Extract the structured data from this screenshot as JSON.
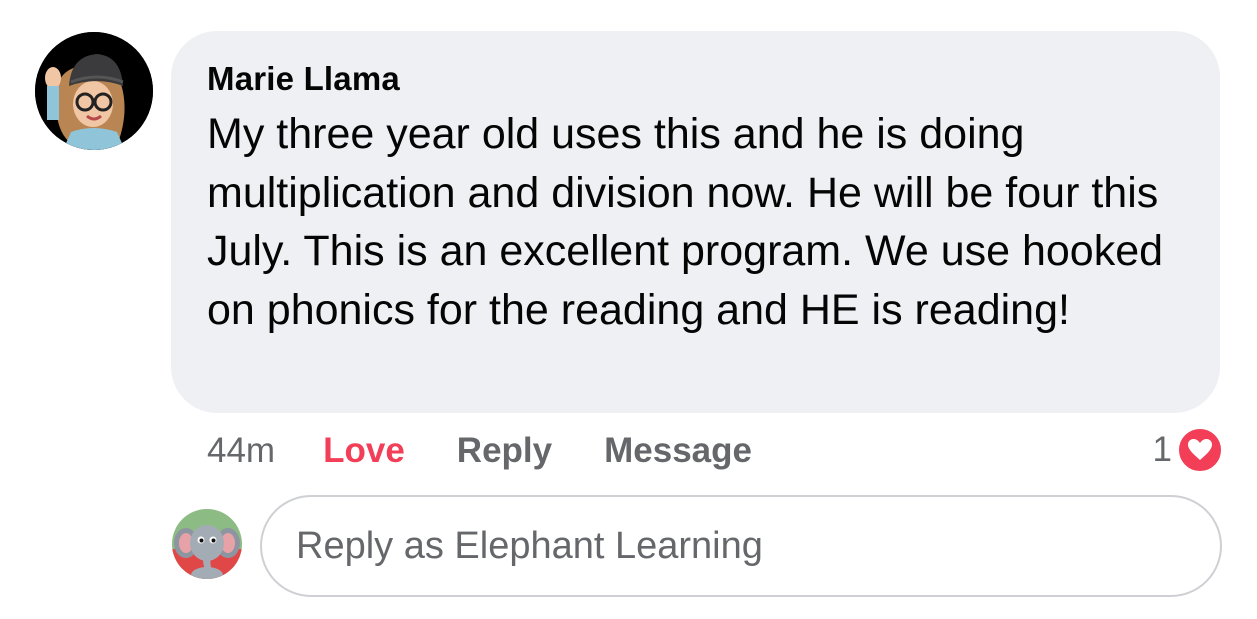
{
  "comment": {
    "author": "Marie Llama",
    "text": "My three year old uses this and he is doing multiplication and division now. He will be four this July. This is an excellent program. We use hooked on phonics for the reading and HE is reading!",
    "avatar_icon": "user-avatar"
  },
  "actions": {
    "time": "44m",
    "love_label": "Love",
    "reply_label": "Reply",
    "message_label": "Message"
  },
  "reactions": {
    "count": "1",
    "icon": "heart-icon"
  },
  "reply_box": {
    "avatar_icon": "elephant-avatar",
    "placeholder": "Reply as Elephant Learning"
  },
  "colors": {
    "bubble_bg": "#eff0f3",
    "love_red": "#f33e58",
    "secondary_text": "#65676b",
    "primary_text": "#050505"
  }
}
